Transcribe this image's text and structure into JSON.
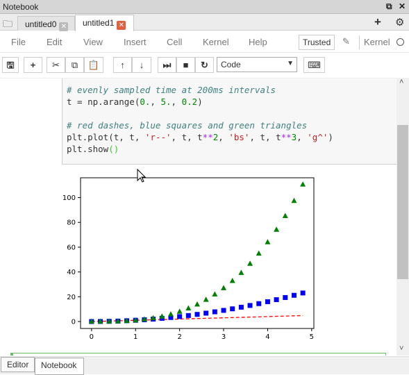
{
  "window": {
    "title": "Notebook",
    "restore_icon": "restore-icon",
    "close_icon": "close-icon"
  },
  "tabs": [
    {
      "label": "untitled0",
      "active": false
    },
    {
      "label": "untitled1",
      "active": true
    }
  ],
  "menu": [
    "File",
    "Edit",
    "View",
    "Insert",
    "Cell",
    "Kernel",
    "Help"
  ],
  "status": {
    "trusted": "Trusted",
    "kernel": "Kernel"
  },
  "toolbar": {
    "cell_type": "Code"
  },
  "code": {
    "comment1": "# evenly sampled time at 200ms intervals",
    "line1": [
      "t = np.arange(",
      "0.",
      ", ",
      "5.",
      ", ",
      "0.2",
      ")"
    ],
    "comment2": "# red dashes, blue squares and green triangles",
    "line2": [
      "plt.plot(t, t, ",
      "'r--'",
      ", t, t",
      "**",
      "2",
      ", ",
      "'bs'",
      ", t, t",
      "**",
      "3",
      ", ",
      "'g^'",
      ")"
    ],
    "line3": [
      "plt.show",
      "()"
    ]
  },
  "bottom_tabs": [
    "Editor",
    "Notebook"
  ],
  "chart_data": {
    "type": "line",
    "xlim": [
      -0.25,
      5.05
    ],
    "ylim": [
      -5.6,
      116
    ],
    "xticks": [
      0,
      1,
      2,
      3,
      4,
      5
    ],
    "yticks": [
      0,
      20,
      40,
      60,
      80,
      100
    ],
    "x": [
      0,
      0.2,
      0.4,
      0.6,
      0.8,
      1,
      1.2,
      1.4,
      1.6,
      1.8,
      2,
      2.2,
      2.4,
      2.6,
      2.8,
      3,
      3.2,
      3.4,
      3.6,
      3.8,
      4,
      4.2,
      4.4,
      4.6,
      4.8
    ],
    "series": [
      {
        "style": "dashed-line",
        "color": "#ff0000",
        "values": [
          0,
          0.2,
          0.4,
          0.6,
          0.8,
          1,
          1.2,
          1.4,
          1.6,
          1.8,
          2,
          2.2,
          2.4,
          2.6,
          2.8,
          3,
          3.2,
          3.4,
          3.6,
          3.8,
          4,
          4.2,
          4.4,
          4.6,
          4.8
        ]
      },
      {
        "style": "square",
        "color": "#0000ff",
        "values": [
          0,
          0.04,
          0.16,
          0.36,
          0.64,
          1,
          1.44,
          1.96,
          2.56,
          3.24,
          4,
          4.84,
          5.76,
          6.76,
          7.84,
          9,
          10.24,
          11.56,
          12.96,
          14.44,
          16,
          17.64,
          19.36,
          21.16,
          23.04
        ]
      },
      {
        "style": "triangle",
        "color": "#008000",
        "values": [
          0,
          0.008,
          0.064,
          0.216,
          0.512,
          1,
          1.728,
          2.744,
          4.096,
          5.832,
          8,
          10.648,
          13.824,
          17.576,
          21.952,
          27,
          32.768,
          39.304,
          46.656,
          54.872,
          64,
          74.088,
          85.184,
          97.336,
          110.592
        ]
      }
    ]
  }
}
